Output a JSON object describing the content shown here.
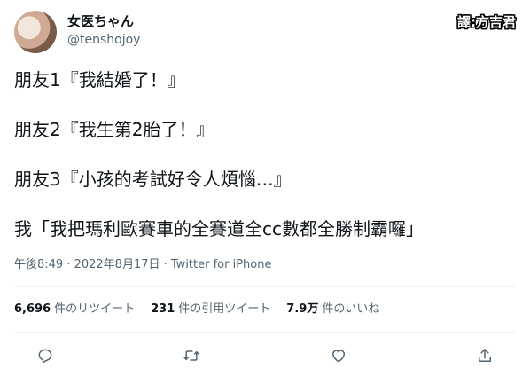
{
  "author": {
    "display_name": "女医ちゃん",
    "handle": "@tenshojoy"
  },
  "watermark": "譯:方吉君",
  "tweet_lines": [
    "朋友1『我結婚了！』",
    "朋友2『我生第2胎了！』",
    "朋友3『小孩的考試好令人煩惱…』",
    "我「我把瑪利歐賽車的全賽道全cc數都全勝制霸囉」"
  ],
  "meta": "午後8:49 · 2022年8月17日 · Twitter for iPhone",
  "stats": {
    "retweets": {
      "count": "6,696",
      "label": "件のリツイート"
    },
    "quotes": {
      "count": "231",
      "label": "件の引用ツイート"
    },
    "likes": {
      "count": "7.9万",
      "label": "件のいいね"
    }
  },
  "action_icons": [
    "reply-icon",
    "retweet-icon",
    "like-icon",
    "share-icon"
  ]
}
